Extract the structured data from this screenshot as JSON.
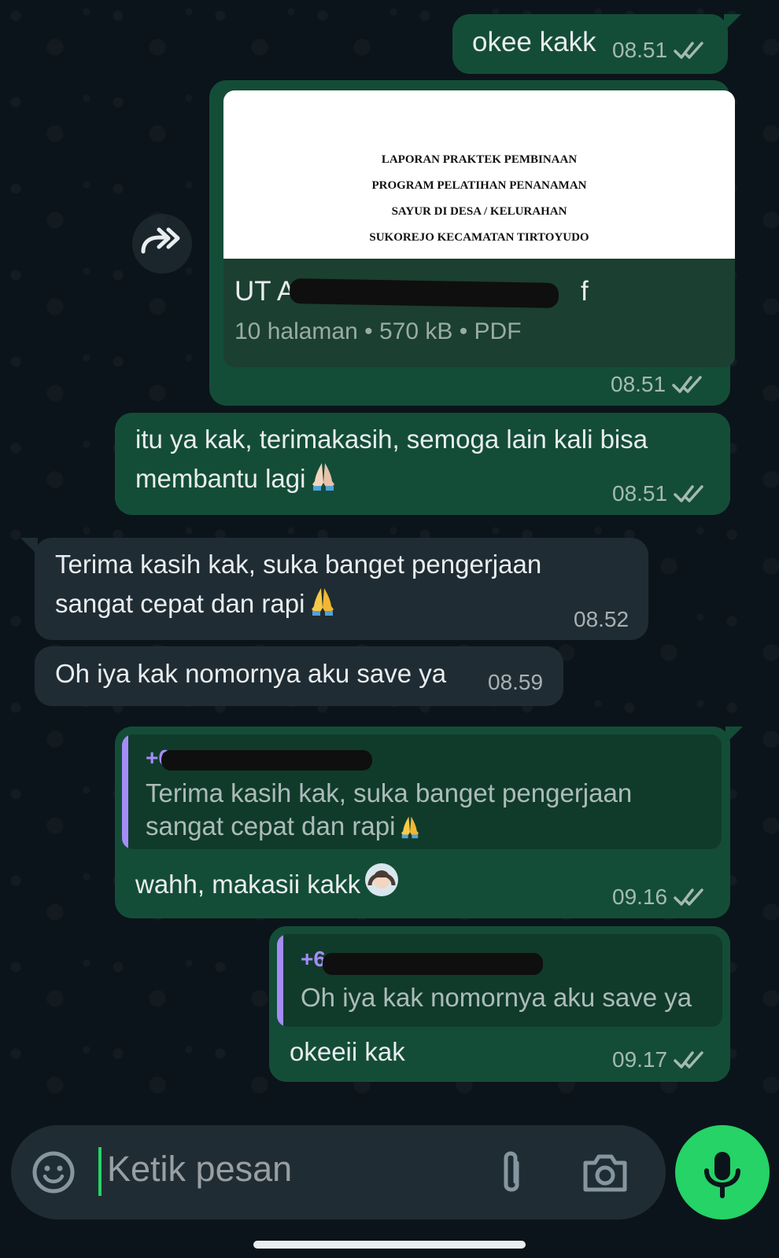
{
  "messages": [
    {
      "text": "okee kakk",
      "time": "08.51"
    },
    {
      "document": {
        "preview_lines": [
          "LAPORAN PRAKTEK PEMBINAAN",
          "PROGRAM PELATIHAN PENANAMAN",
          "SAYUR DI DESA / KELURAHAN",
          "SUKOREJO KECAMATAN TIRTOYUDO"
        ],
        "name_start": "UT A",
        "name_end": "f",
        "info": "10 halaman • 570 kB • PDF"
      },
      "time": "08.51"
    },
    {
      "line1": "itu ya kak, terimakasih, semoga lain kali bisa",
      "line2": "membantu lagi",
      "time": "08.51"
    },
    {
      "line1": "Terima kasih kak, suka banget pengerjaan",
      "line2": "sangat cepat dan rapi",
      "time": "08.52"
    },
    {
      "text": "Oh iya kak nomornya aku save ya",
      "time": "08.59"
    },
    {
      "quote": {
        "author": "+6",
        "line1": "Terima kasih kak, suka banget pengerjaan",
        "line2": "sangat cepat dan rapi"
      },
      "text": "wahh, makasii kakk",
      "time": "09.16"
    },
    {
      "quote": {
        "author": "+6",
        "text": "Oh iya kak nomornya aku save ya"
      },
      "text": "okeeii kak",
      "time": "09.17"
    }
  ],
  "input": {
    "placeholder": "Ketik pesan"
  },
  "icons": {
    "forward": "forward-icon",
    "emoji": "emoji-icon",
    "attach": "paperclip-icon",
    "camera": "camera-icon",
    "mic": "microphone-icon",
    "read_receipt": "double-check-icon"
  },
  "colors": {
    "outgoing_bubble": "#144d37",
    "incoming_bubble": "#202c33",
    "accent_green": "#25d366",
    "quote_author": "#a68cf7",
    "background": "#0b141a"
  }
}
